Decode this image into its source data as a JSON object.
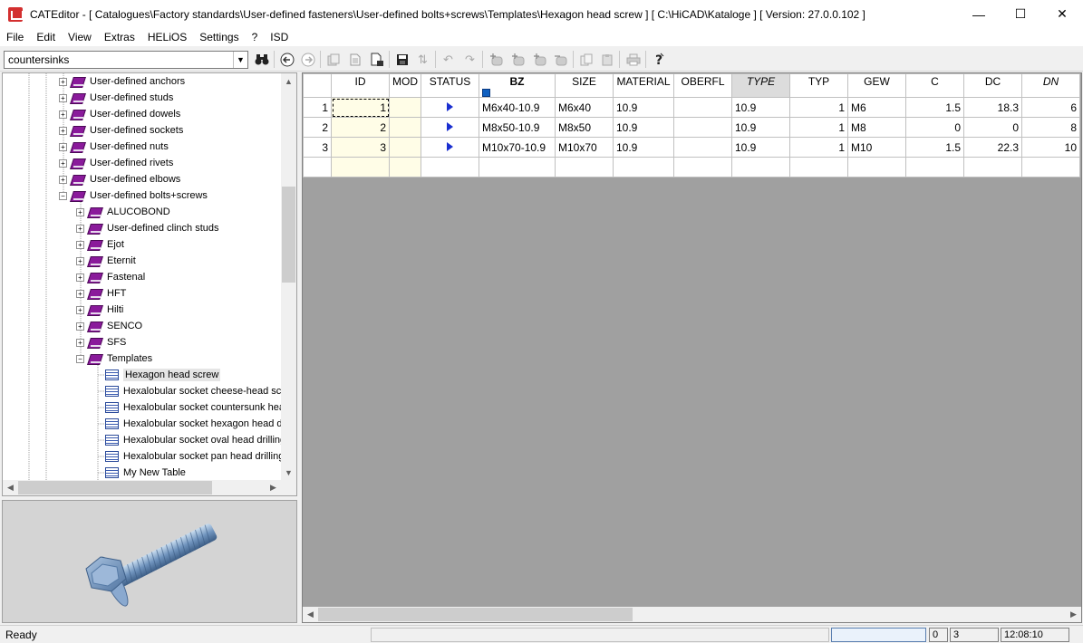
{
  "window": {
    "title": "CATEditor - [ Catalogues\\Factory standards\\User-defined fasteners\\User-defined bolts+screws\\Templates\\Hexagon head screw ]     [ C:\\HiCAD\\Kataloge ]   [ Version: 27.0.0.102 ]",
    "minimize": "—",
    "maximize": "☐",
    "close": "✕"
  },
  "menu": [
    "File",
    "Edit",
    "View",
    "Extras",
    "HELiOS",
    "Settings",
    "?",
    "ISD"
  ],
  "search": {
    "value": "countersinks"
  },
  "tree": [
    {
      "label": "User-defined anchors",
      "level": 1,
      "icon": "book",
      "expander": "+"
    },
    {
      "label": "User-defined studs",
      "level": 1,
      "icon": "book",
      "expander": "+"
    },
    {
      "label": "User-defined dowels",
      "level": 1,
      "icon": "book",
      "expander": "+"
    },
    {
      "label": "User-defined sockets",
      "level": 1,
      "icon": "book",
      "expander": "+"
    },
    {
      "label": "User-defined nuts",
      "level": 1,
      "icon": "book",
      "expander": "+"
    },
    {
      "label": "User-defined rivets",
      "level": 1,
      "icon": "book",
      "expander": "+"
    },
    {
      "label": "User-defined elbows",
      "level": 1,
      "icon": "book",
      "expander": "+"
    },
    {
      "label": "User-defined bolts+screws",
      "level": 1,
      "icon": "book",
      "expander": "-"
    },
    {
      "label": "ALUCOBOND",
      "level": 2,
      "icon": "book",
      "expander": "+"
    },
    {
      "label": "User-defined clinch studs",
      "level": 2,
      "icon": "book",
      "expander": "+"
    },
    {
      "label": "Ejot",
      "level": 2,
      "icon": "book",
      "expander": "+"
    },
    {
      "label": "Eternit",
      "level": 2,
      "icon": "book",
      "expander": "+"
    },
    {
      "label": "Fastenal",
      "level": 2,
      "icon": "book",
      "expander": "+"
    },
    {
      "label": "HFT",
      "level": 2,
      "icon": "book",
      "expander": "+"
    },
    {
      "label": "Hilti",
      "level": 2,
      "icon": "book",
      "expander": "+"
    },
    {
      "label": "SENCO",
      "level": 2,
      "icon": "book",
      "expander": "+"
    },
    {
      "label": "SFS",
      "level": 2,
      "icon": "book",
      "expander": "+"
    },
    {
      "label": "Templates",
      "level": 2,
      "icon": "book",
      "expander": "-"
    },
    {
      "label": "Hexagon head screw",
      "level": 3,
      "icon": "table",
      "expander": "",
      "selected": true
    },
    {
      "label": "Hexalobular socket cheese-head screw",
      "level": 3,
      "icon": "table",
      "expander": ""
    },
    {
      "label": "Hexalobular socket countersunk head",
      "level": 3,
      "icon": "table",
      "expander": ""
    },
    {
      "label": "Hexalobular socket hexagon head drilling",
      "level": 3,
      "icon": "table",
      "expander": ""
    },
    {
      "label": "Hexalobular socket oval head drilling",
      "level": 3,
      "icon": "table",
      "expander": ""
    },
    {
      "label": "Hexalobular socket pan head drilling",
      "level": 3,
      "icon": "table",
      "expander": ""
    },
    {
      "label": "My New Table",
      "level": 3,
      "icon": "table",
      "expander": ""
    }
  ],
  "grid": {
    "columns": [
      {
        "key": "ID",
        "label": "ID"
      },
      {
        "key": "MOD",
        "label": "MOD"
      },
      {
        "key": "STATUS",
        "label": "STATUS"
      },
      {
        "key": "BZ",
        "label": "BZ",
        "style": "bold"
      },
      {
        "key": "SIZE",
        "label": "SIZE"
      },
      {
        "key": "MATERIAL",
        "label": "MATERIAL"
      },
      {
        "key": "OBERFL",
        "label": "OBERFL"
      },
      {
        "key": "TYPE",
        "label": "TYPE",
        "style": "italic-shaded"
      },
      {
        "key": "TYP",
        "label": "TYP"
      },
      {
        "key": "GEW",
        "label": "GEW"
      },
      {
        "key": "C",
        "label": "C"
      },
      {
        "key": "DC",
        "label": "DC"
      },
      {
        "key": "DN",
        "label": "DN",
        "style": "italic"
      }
    ],
    "rows": [
      {
        "num": "1",
        "ID": "1",
        "MOD": "",
        "BZ": "M6x40-10.9",
        "SIZE": "M6x40",
        "MATERIAL": "10.9",
        "OBERFL": "",
        "TYPE": "10.9",
        "TYP": "1",
        "GEW": "M6",
        "C": "1.5",
        "DC": "18.3",
        "DN": "6"
      },
      {
        "num": "2",
        "ID": "2",
        "MOD": "",
        "BZ": "M8x50-10.9",
        "SIZE": "M8x50",
        "MATERIAL": "10.9",
        "OBERFL": "",
        "TYPE": "10.9",
        "TYP": "1",
        "GEW": "M8",
        "C": "0",
        "DC": "0",
        "DN": "8"
      },
      {
        "num": "3",
        "ID": "3",
        "MOD": "",
        "BZ": "M10x70-10.9",
        "SIZE": "M10x70",
        "MATERIAL": "10.9",
        "OBERFL": "",
        "TYPE": "10.9",
        "TYP": "1",
        "GEW": "M10",
        "C": "1.5",
        "DC": "22.3",
        "DN": "10"
      }
    ]
  },
  "status": {
    "text": "Ready",
    "field1": "",
    "field2": "0",
    "field3": "3",
    "time": "12:08:10"
  },
  "colors": {
    "book": "#8a1a9b",
    "status_arrow": "#1a2fd0",
    "id_column": "#fffde7",
    "grid_empty": "#a0a0a0"
  }
}
